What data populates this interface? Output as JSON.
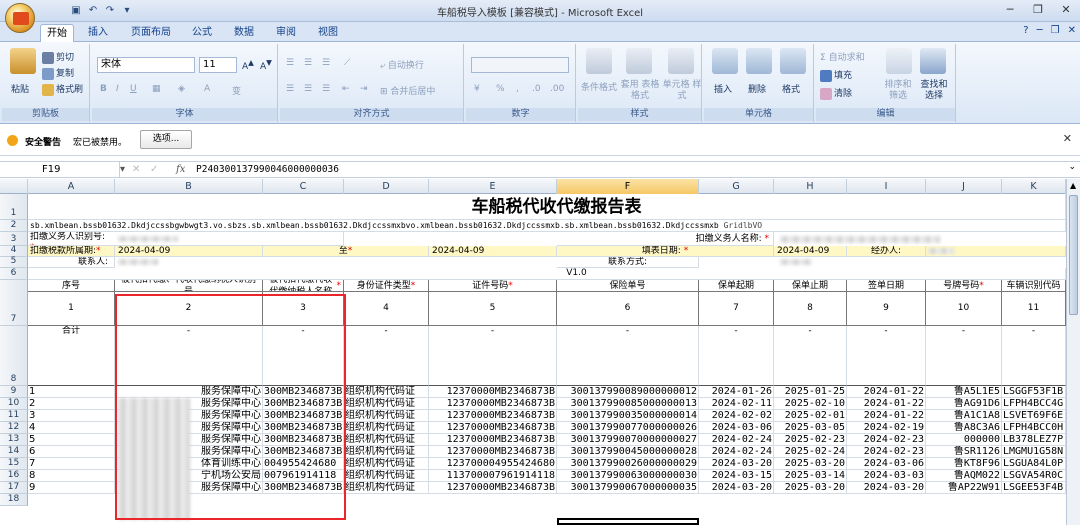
{
  "window": {
    "title": "车船税导入模板  [兼容模式] - Microsoft Excel"
  },
  "tabs": [
    "开始",
    "插入",
    "页面布局",
    "公式",
    "数据",
    "审阅",
    "视图"
  ],
  "ribbon": {
    "clipboard": {
      "group": "剪贴板",
      "paste": "粘贴",
      "cut": "剪切",
      "copy": "复制",
      "format_painter": "格式刷"
    },
    "font": {
      "group": "字体",
      "name": "宋体",
      "size": "11"
    },
    "alignment": {
      "group": "对齐方式",
      "wrap": "自动换行",
      "merge": "合并后居中"
    },
    "number": {
      "group": "数字"
    },
    "styles": {
      "group": "样式",
      "conditional": "条件格式",
      "table": "套用 表格格式",
      "cell_style": "单元格 样式"
    },
    "cells": {
      "group": "单元格",
      "insert": "插入",
      "delete": "删除",
      "format": "格式"
    },
    "editing": {
      "group": "编辑",
      "autosum": "自动求和",
      "fill": "填充",
      "clear": "清除",
      "sort": "排序和 筛选",
      "find": "查找和 选择"
    }
  },
  "security": {
    "label": "安全警告",
    "message": "宏已被禁用。",
    "options": "选项..."
  },
  "formula_bar": {
    "name_box": "F19",
    "fx": "fx",
    "value": "P240300137990046000000036"
  },
  "columns": [
    "A",
    "B",
    "C",
    "D",
    "E",
    "F",
    "G",
    "H",
    "I",
    "J",
    "K"
  ],
  "selected_column": "F",
  "rows": [
    "1",
    "2",
    "3",
    "4",
    "5",
    "6",
    "7",
    "8",
    "9",
    "10",
    "11",
    "12",
    "13",
    "14",
    "15",
    "16",
    "17",
    "18"
  ],
  "sheet": {
    "title": "车船税代收代缴报告表",
    "row2_text": "sb.xmlbean.bssb01632.Dkdjccssbgwbwgt3.vo.sbzs.sb.xmlbean.bssb01632.Dkdjccssmxbvo.xmlbean.bssb01632.Dkdjccssmxb.sb.xmlbean.bssb01632.Dkdjccssmxb",
    "row2_tail": "GridlbVO",
    "agent_id_label": "扣缴义务人识别号:",
    "agent_name_label": "扣缴义务人名称:",
    "period_label": "扣缴税款所属期:",
    "period_from": "2024-04-09",
    "to_label": "至",
    "period_to": "2024-04-09",
    "fill_date_label": "填表日期:",
    "fill_date": "2024-04-09",
    "handler_label": "经办人:",
    "contact_label": "联系人:",
    "contact_method_label": "联系方式:",
    "version": "V1.0",
    "headers": [
      "序号",
      "被代扣代缴、代收代缴纳税人识别号",
      "被代扣代缴代收代缴纳税人名称",
      "身份证件类型",
      "证件号码",
      "保险单号",
      "保单起期",
      "保单止期",
      "签单日期",
      "号牌号码",
      "车辆识别代码"
    ],
    "header_required": [
      false,
      false,
      true,
      true,
      true,
      false,
      false,
      false,
      false,
      true,
      false
    ],
    "col_numbers": [
      "1",
      "2",
      "3",
      "4",
      "5",
      "6",
      "7",
      "8",
      "9",
      "10",
      "11"
    ],
    "total_label": "合计",
    "dash": "-",
    "data": [
      [
        "1",
        "服务保障中心",
        "300MB2346873B",
        "组织机构代码证",
        "12370000MB2346873B",
        "300137990089000000012",
        "2024-01-26",
        "2025-01-25",
        "2024-01-22",
        "鲁A5L1E5",
        "LSGGF53F1B"
      ],
      [
        "2",
        "服务保障中心",
        "300MB2346873B",
        "组织机构代码证",
        "12370000MB2346873B",
        "300137990085000000013",
        "2024-02-11",
        "2025-02-10",
        "2024-01-22",
        "鲁AG91D6",
        "LFPH4BCC4G"
      ],
      [
        "3",
        "服务保障中心",
        "300MB2346873B",
        "组织机构代码证",
        "12370000MB2346873B",
        "300137990035000000014",
        "2024-02-02",
        "2025-02-01",
        "2024-01-22",
        "鲁A1C1A8",
        "LSVET69F6E"
      ],
      [
        "4",
        "服务保障中心",
        "300MB2346873B",
        "组织机构代码证",
        "12370000MB2346873B",
        "300137990077000000026",
        "2024-03-06",
        "2025-03-05",
        "2024-02-19",
        "鲁A8C3A6",
        "LFPH4BCC0H"
      ],
      [
        "5",
        "服务保障中心",
        "300MB2346873B",
        "组织机构代码证",
        "12370000MB2346873B",
        "300137990070000000027",
        "2024-02-24",
        "2025-02-23",
        "2024-02-23",
        "000000",
        "LB378LEZ7P"
      ],
      [
        "6",
        "服务保障中心",
        "300MB2346873B",
        "组织机构代码证",
        "12370000MB2346873B",
        "300137990045000000028",
        "2024-02-24",
        "2025-02-24",
        "2024-02-23",
        "鲁SR1126",
        "LMGMU1G58N"
      ],
      [
        "7",
        "体育训练中心",
        "004955424680",
        "组织机构代码证",
        "123700004955424680",
        "300137990026000000029",
        "2024-03-20",
        "2025-03-20",
        "2024-03-06",
        "鲁KT8F96",
        "LSGUA84L0P"
      ],
      [
        "8",
        "宁机场公安局",
        "007961914118",
        "组织机构代码证",
        "113700007961914118",
        "300137990063000000030",
        "2024-03-15",
        "2025-03-14",
        "2024-03-03",
        "鲁AQM022",
        "LSGVA54R0C"
      ],
      [
        "9",
        "服务保障中心",
        "300MB2346873B",
        "组织机构代码证",
        "12370000MB2346873B",
        "300137990067000000035",
        "2024-03-20",
        "2025-03-20",
        "2024-03-20",
        "鲁AP22W91",
        "LSGEE53F4B"
      ]
    ]
  }
}
